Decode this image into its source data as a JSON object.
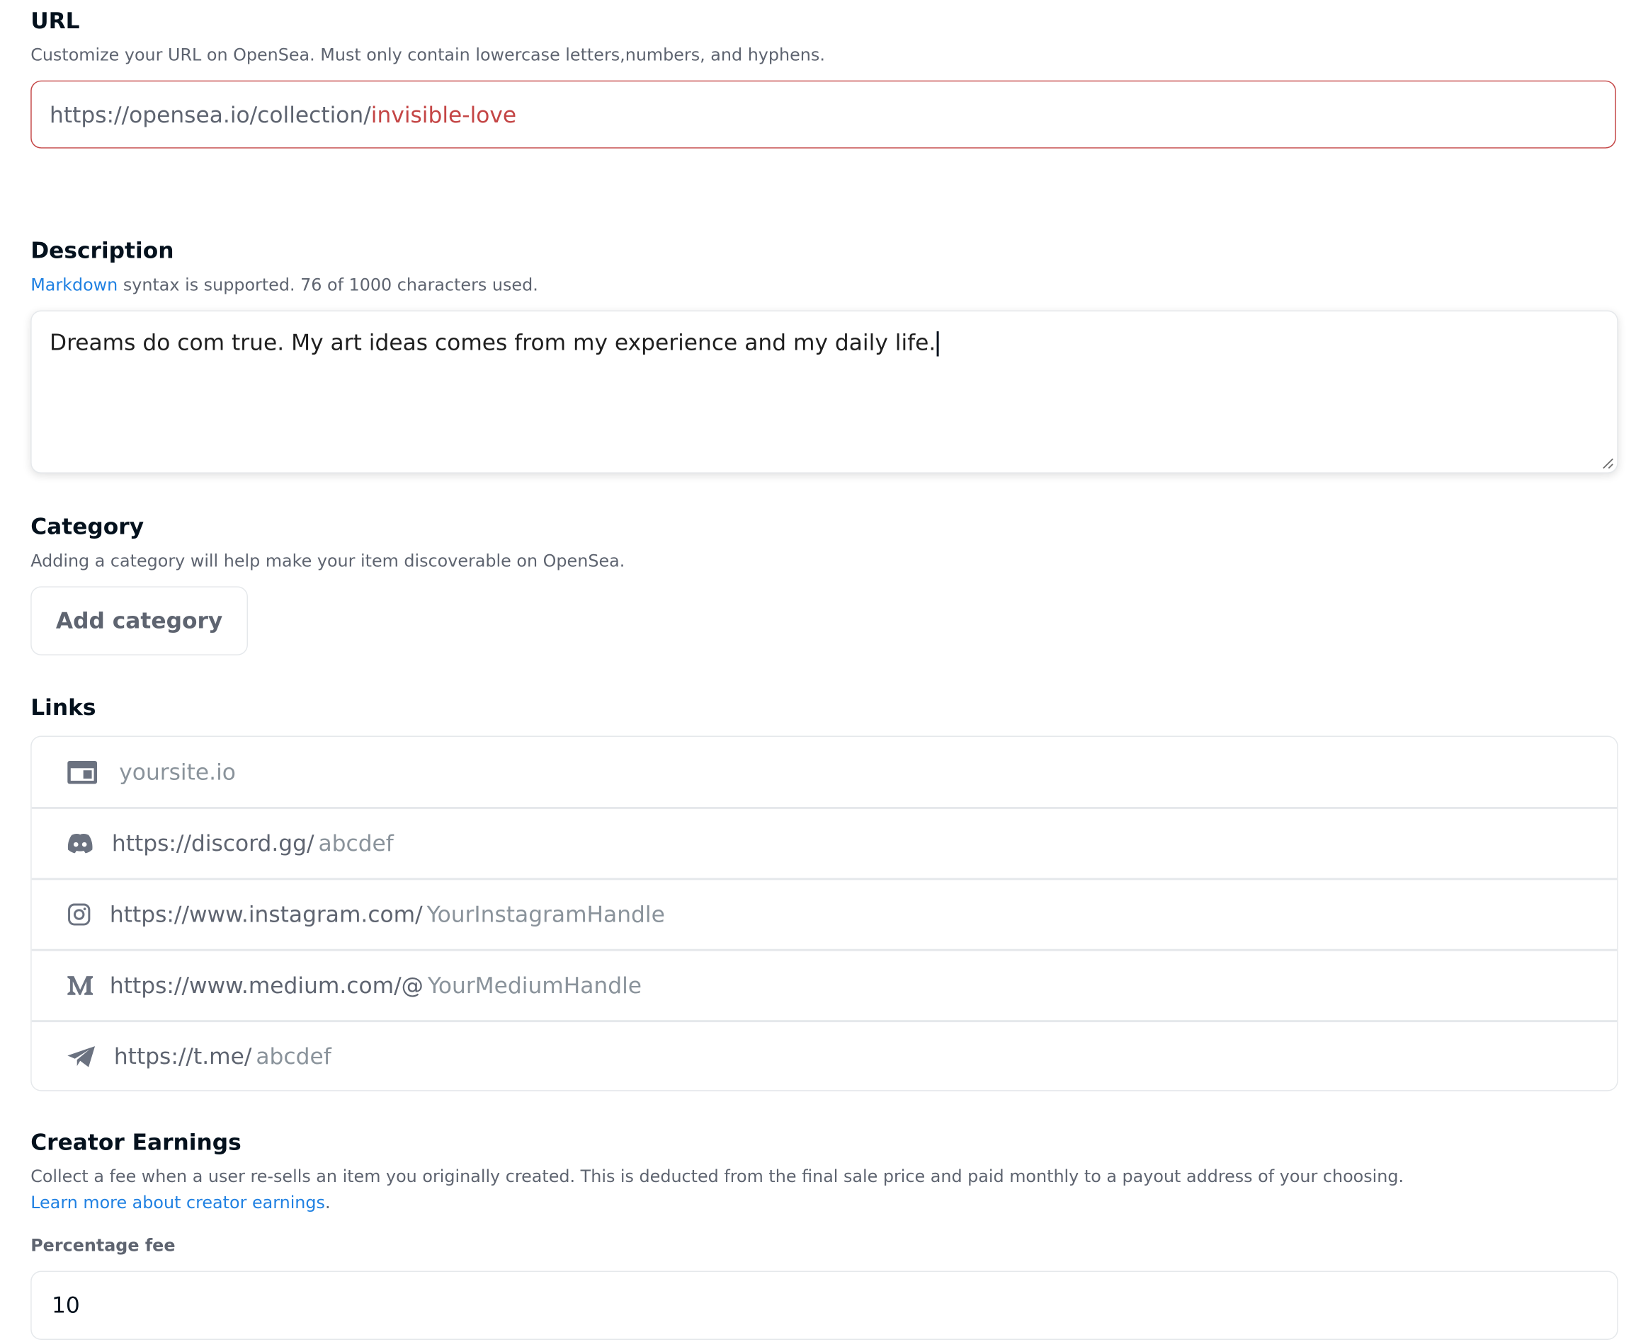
{
  "url_section": {
    "title": "URL",
    "help": "Customize your URL on OpenSea. Must only contain lowercase letters,numbers, and hyphens.",
    "prefix": "https://opensea.io/collection/",
    "value": "invisible-love"
  },
  "description_section": {
    "title": "Description",
    "markdown_link": "Markdown",
    "help_rest": " syntax is supported. 76 of 1000 characters used.",
    "value": "Dreams do com true. My art ideas comes from my experience and my daily life."
  },
  "category_section": {
    "title": "Category",
    "help": "Adding a category will help make your item discoverable on OpenSea.",
    "button_label": "Add category"
  },
  "links_section": {
    "title": "Links",
    "items": [
      {
        "icon": "website-icon",
        "prefix": "",
        "placeholder": "yoursite.io"
      },
      {
        "icon": "discord-icon",
        "prefix": "https://discord.gg/",
        "placeholder": "abcdef"
      },
      {
        "icon": "instagram-icon",
        "prefix": "https://www.instagram.com/",
        "placeholder": "YourInstagramHandle"
      },
      {
        "icon": "medium-icon",
        "prefix": "https://www.medium.com/@",
        "placeholder": "YourMediumHandle"
      },
      {
        "icon": "telegram-icon",
        "prefix": "https://t.me/",
        "placeholder": "abcdef"
      }
    ]
  },
  "earnings_section": {
    "title": "Creator Earnings",
    "help": "Collect a fee when a user re-sells an item you originally created. This is deducted from the final sale price and paid monthly to a payout address of your choosing.",
    "learn_more": "Learn more about creator earnings",
    "learn_more_suffix": ".",
    "fee_label": "Percentage fee",
    "fee_value": "10"
  },
  "colors": {
    "error": "#c44545",
    "link": "#2081e2",
    "border": "#e5e8eb",
    "muted_text": "#5e6470",
    "placeholder": "#8a939b"
  }
}
